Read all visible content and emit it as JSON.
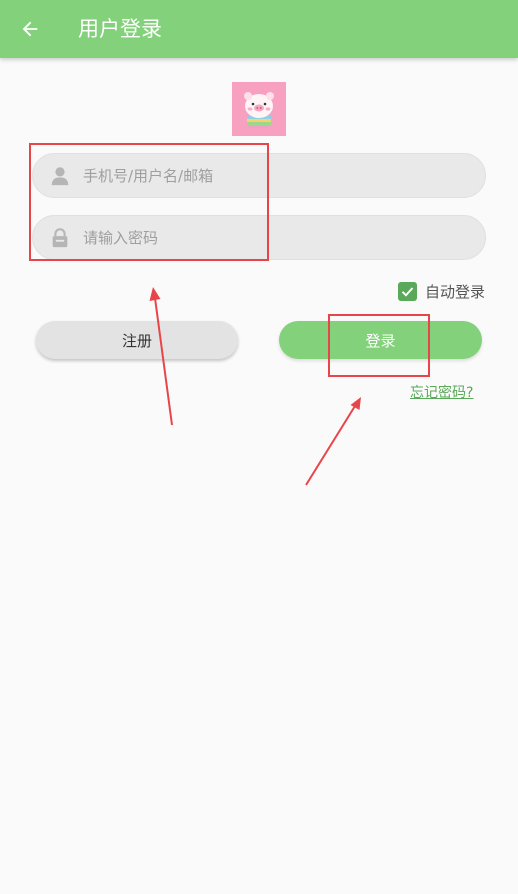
{
  "toolbar": {
    "title": "用户登录",
    "back_icon": "arrow-left-icon",
    "color": "#83d17b"
  },
  "avatar": {
    "icon": "pig-avatar-icon"
  },
  "form": {
    "phone_placeholder": "手机号/用户名/邮箱",
    "phone_icon": "user-icon",
    "password_placeholder": "请输入密码",
    "password_icon": "lock-icon",
    "auto_login_label": "自动登录",
    "auto_login_checked": true,
    "register_label": "注册",
    "login_label": "登录",
    "forgot_label": "忘记密码?"
  },
  "colors": {
    "accent": "#83d17b",
    "checkbox": "#5aa85a",
    "annotation": "#e8454a"
  }
}
